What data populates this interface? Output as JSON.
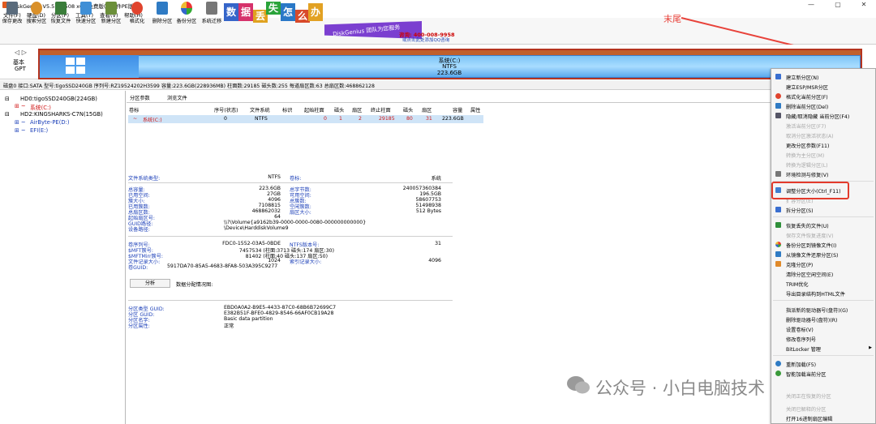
{
  "window": {
    "title": "DiskGenius V5.5.1.1508 x64 免费版(单文件PE版)",
    "min": "—",
    "max": "▢",
    "close": "✕"
  },
  "menu": [
    "文件(F)",
    "硬盘(D)",
    "分区(P)",
    "工具(T)",
    "查看(V)",
    "帮助(H)"
  ],
  "toolbar": [
    "保存更改",
    "搜索分区",
    "恢复文件",
    "快速分区",
    "新建分区",
    "格式化",
    "删除分区",
    "备份分区",
    "系统迁移"
  ],
  "banner": {
    "chars": [
      "数",
      "据",
      "丢",
      "失",
      "怎",
      "么",
      "办"
    ],
    "team": "DiskGenius 团队为您服务",
    "phone": "咨询: 400-008-9958",
    "qq": "或点击此处添加QQ咨询"
  },
  "annotation": "末尾",
  "disk": {
    "nav": "◁ ▷",
    "type1": "基本",
    "type2": "GPT",
    "partition_name": "系统(C:)",
    "fs": "NTFS",
    "size": "223.6GB"
  },
  "infobar": "磁盘0 接口:SATA 型号:tigoSSD240GB 序列号:RZ19524202H3599 容量:223.6GB(228936MB) 柱面数:29185 磁头数:255 每道扇区数:63 总扇区数:468862128",
  "tree": [
    "HD0:tigoSSD240GB(224GB)",
    "系统(C:)",
    "HD2:KINGSHARKS-C7N(15GB)",
    "AirByte-PE(D:)",
    "EFI(E:)"
  ],
  "tabs": [
    "分区参数",
    "浏览文件"
  ],
  "table": {
    "headers": [
      "卷标",
      "序号(状态)",
      "文件系统",
      "标识",
      "起始柱面",
      "磁头",
      "扇区",
      "终止柱面",
      "磁头",
      "扇区",
      "容量",
      "属性"
    ],
    "row": [
      "系统(C:)",
      "0",
      "NTFS",
      "",
      "0",
      "1",
      "2",
      "29185",
      "80",
      "31",
      "223.6GB",
      ""
    ]
  },
  "details": {
    "fs_type_label": "文件系统类型:",
    "fs_type": "NTFS",
    "vol_label": "卷标:",
    "vol": "系统",
    "left_labels": [
      "总容量:",
      "已用空间:",
      "簇大小:",
      "已用簇数:",
      "总扇区数:",
      "起始扇区号:",
      "GUID路径:",
      "设备路径:"
    ],
    "left_values": [
      "223.6GB",
      "27GB",
      "4096",
      "7108815",
      "468862032",
      "64",
      "\\\\?\\Volume{a9162b39-0000-0000-0080-000000000000}",
      "\\Device\\HarddiskVolume9"
    ],
    "right_labels": [
      "总字节数:",
      "可用空间:",
      "总簇数:",
      "空闲簇数:",
      "扇区大小:"
    ],
    "right_values": [
      "240057360384",
      "196.5GB",
      "58607753",
      "51498938",
      "512 Bytes"
    ],
    "ntfs_labels": [
      "卷序列号:",
      "$MFT簇号:",
      "$MFTMirr簇号:",
      "文件记录大小:",
      "卷GUID:"
    ],
    "ntfs_values": [
      "FDC0-1552-03A5-0BDE",
      "7457534 (柱面:3713 磁头:174 扇区:30)",
      "81402 (柱面:40 磁头:137 扇区:50)",
      "1024",
      "5917DA70-85A5-4683-8FA8-503A395C9277"
    ],
    "ntfs_r_labels": [
      "NTFS版本号:",
      "",
      "",
      "索引记录大小:"
    ],
    "ntfs_r_values": [
      "31",
      "",
      "",
      "4096"
    ],
    "analyze": "分析",
    "alloc": "数据分配情况图:",
    "guid_labels": [
      "分区类型 GUID:",
      "分区 GUID:",
      "分区名字:",
      "分区属性:"
    ],
    "guid_values": [
      "EBD0A0A2-B9E5-4433-87C0-68B6B72699C7",
      "E382B51F-BFE0-4829-8546-66AF0CB19A28",
      "Basic data partition",
      "正常"
    ]
  },
  "context_menu": [
    "建立新分区(N)",
    "建立ESP/MSR分区",
    "格式化当前分区(F)",
    "删除当前分区(Del)",
    "隐藏/取消隐藏 当前分区(F4)",
    "激活当前分区(F7)",
    "取消分区激活状态(A)",
    "更改分区参数(F11)",
    "转换为主分区(M)",
    "转换为逻辑分区(L)",
    "环境检测与修复(V)",
    "调整分区大小(Ctrl_F11)",
    "扩容分区(E)",
    "拆分分区(S)",
    "恢复丢失的文件(U)",
    "保存文件恢复进度(V)",
    "备份分区到镜像文件(I)",
    "从镜像文件还原分区(S)",
    "克隆分区(P)",
    "清除分区空闲空间(E)",
    "TRIM优化",
    "导出目录结构到HTML文件",
    "指派新的驱动器号(盘符)(G)",
    "删除驱动器号(盘符)(R)",
    "设置卷标(V)",
    "修改卷序列号",
    "BitLocker 管理",
    "重新加载(F5)",
    "智能加载当前分区",
    "关闭正在恢复的分区",
    "关闭已解释的分区",
    "打开16进制扇区编辑"
  ],
  "watermark": "公众号 · 小白电脑技术"
}
